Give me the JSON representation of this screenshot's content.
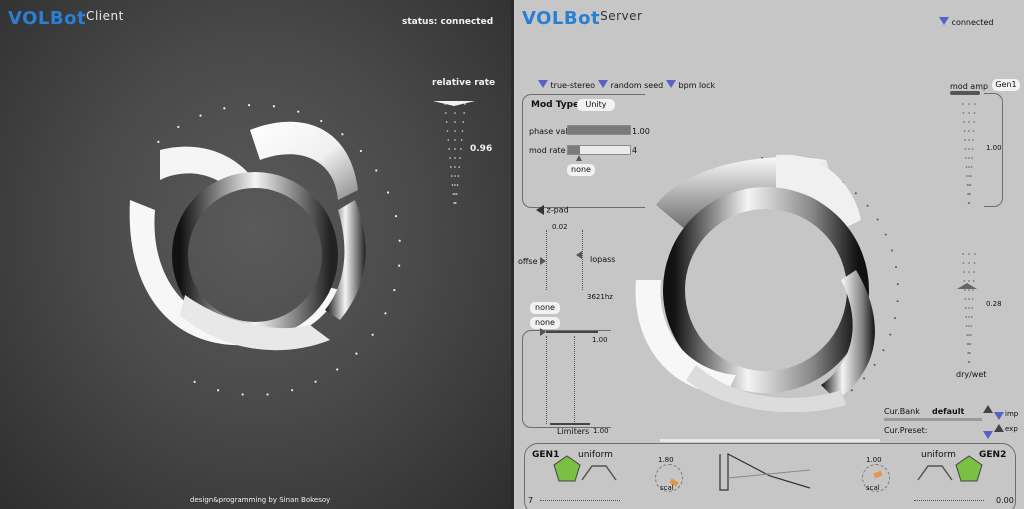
{
  "client": {
    "brand": "VOLBot",
    "brand_sub": "Client",
    "status_text": "status: connected",
    "relative_rate_label": "relative rate",
    "relative_rate_value": "0.96",
    "credit": "design&programming by Sinan Bokesoy"
  },
  "server": {
    "brand": "VOLBot",
    "brand_sub": "Server",
    "connected_label": "connected",
    "toggles": {
      "true_stereo": "true-stereo",
      "random_seed": "random seed",
      "bpm_lock": "bpm lock"
    },
    "mod_type_label": "Mod Type:",
    "mod_type_value": "Unity",
    "phase_val_label": "phase val.",
    "phase_val_value": "1.00",
    "phase_val_fraction": 1.0,
    "mod_rate_label": "mod rate",
    "mod_rate_value": "4",
    "mod_rate_fraction": 0.2,
    "none_a": "none",
    "zpad_label": "z-pad",
    "offset_label": "offse",
    "offset_value": "0.02",
    "lowpass_label": "lopass",
    "lowpass_value": "3621hz",
    "none_b": "none",
    "none_c": "none",
    "limiter_top_value": "1.00",
    "limiters_label": "Limiters",
    "limiters_value": "1.00",
    "mod_amp_label": "mod amp",
    "gen_select": "Gen1",
    "mod_amp_value": "1.00",
    "dry_wet_value": "0.28",
    "dry_wet_label": "dry/wet",
    "cur_bank_label": "Cur.Bank",
    "cur_bank_value": "default",
    "cur_preset_label": "Cur.Preset:",
    "imp_label": "imp",
    "exp_label": "exp",
    "gen1_label": "GEN1",
    "gen1_dist": "uniform",
    "gen1_knob_value": "1.80",
    "gen1_knob_label": "scal",
    "gen2_knob_value": "1.00",
    "gen2_knob_label": "scal",
    "gen2_dist": "uniform",
    "gen2_label": "GEN2",
    "bottom_left_value": "7",
    "bottom_right_value": "0.00"
  },
  "colors": {
    "brand_blue": "#2a7fd4",
    "triangle_blue": "#5861c7",
    "gen_green": "#7ac143",
    "knob_orange": "#e8944a"
  }
}
